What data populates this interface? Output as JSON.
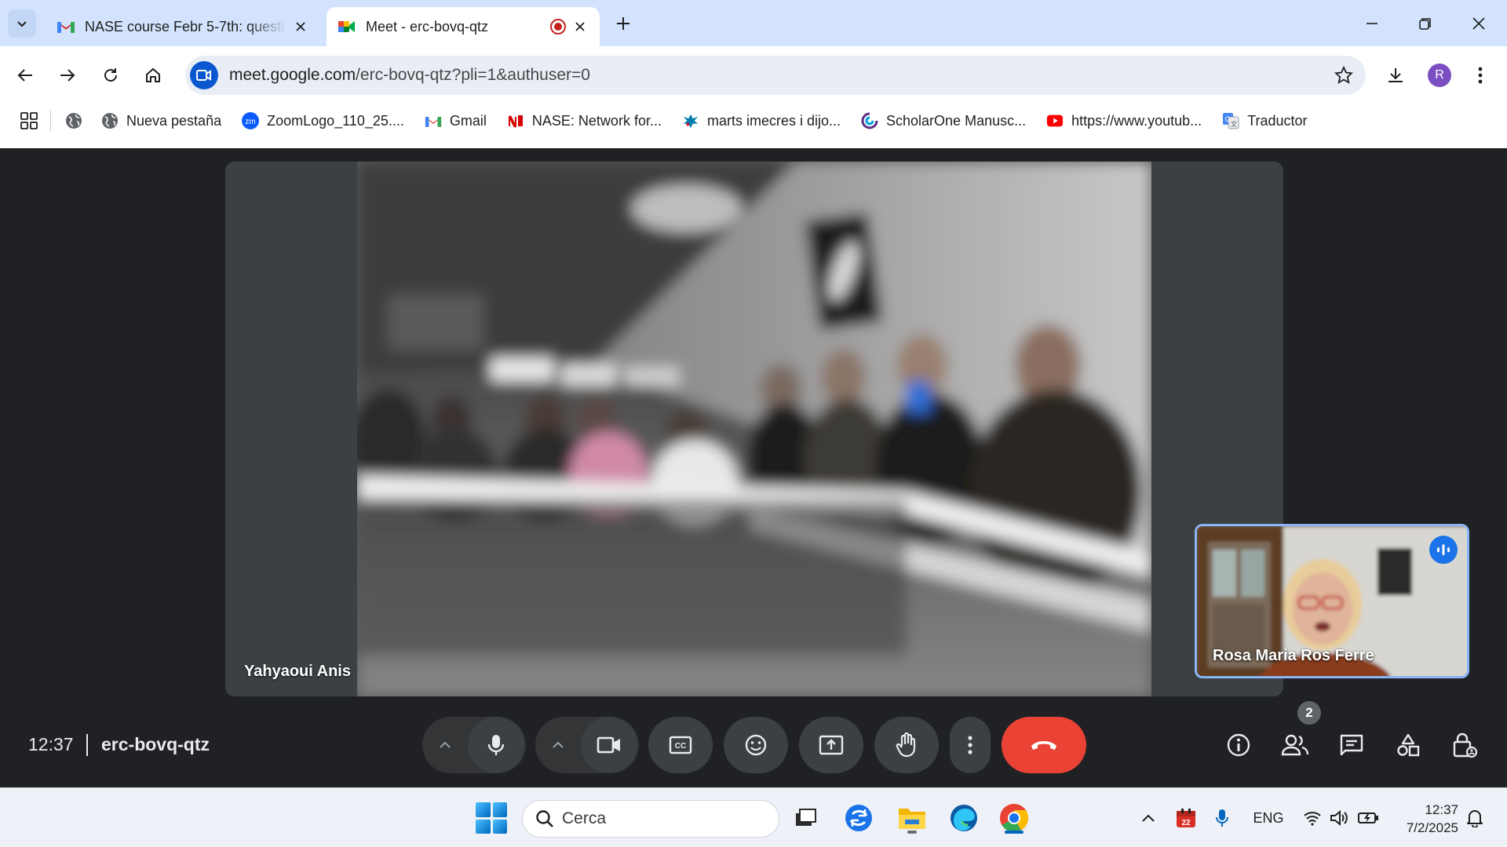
{
  "browser": {
    "tabs": [
      {
        "label": "NASE course Febr 5-7th: questi",
        "icon": "gmail-icon",
        "active": false
      },
      {
        "label": "Meet - erc-bovq-qtz",
        "icon": "meet-icon",
        "active": true,
        "recording": true
      }
    ],
    "url_host": "meet.google.com",
    "url_path": "/erc-bovq-qtz?pli=1&authuser=0",
    "profile_initial": "R"
  },
  "bookmarks": [
    {
      "label": "",
      "icon": "globe-icon"
    },
    {
      "label": "Nueva pestaña",
      "icon": "globe-icon"
    },
    {
      "label": "ZoomLogo_110_25....",
      "icon": "zoom-icon"
    },
    {
      "label": "Gmail",
      "icon": "gmail-icon"
    },
    {
      "label": "NASE: Network for...",
      "icon": "nase-icon"
    },
    {
      "label": "marts imecres i dijo...",
      "icon": "caixabank-icon"
    },
    {
      "label": "ScholarOne Manusc...",
      "icon": "scholarone-icon"
    },
    {
      "label": "https://www.youtub...",
      "icon": "youtube-icon"
    },
    {
      "label": "Traductor",
      "icon": "translate-icon"
    }
  ],
  "meeting": {
    "main_participant": "Yahyaoui Anis",
    "self_participant": "Rosa Maria Ros Ferre",
    "time": "12:37",
    "code": "erc-bovq-qtz",
    "participant_count": "2"
  },
  "taskbar": {
    "search_placeholder": "Cerca",
    "language": "ENG",
    "time": "12:37",
    "date": "7/2/2025",
    "calendar_badge": "22"
  },
  "colors": {
    "accent": "#1a73e8",
    "end_call": "#ea4335",
    "meet_bg": "#202124",
    "tabbar": "#d3e3fd"
  }
}
